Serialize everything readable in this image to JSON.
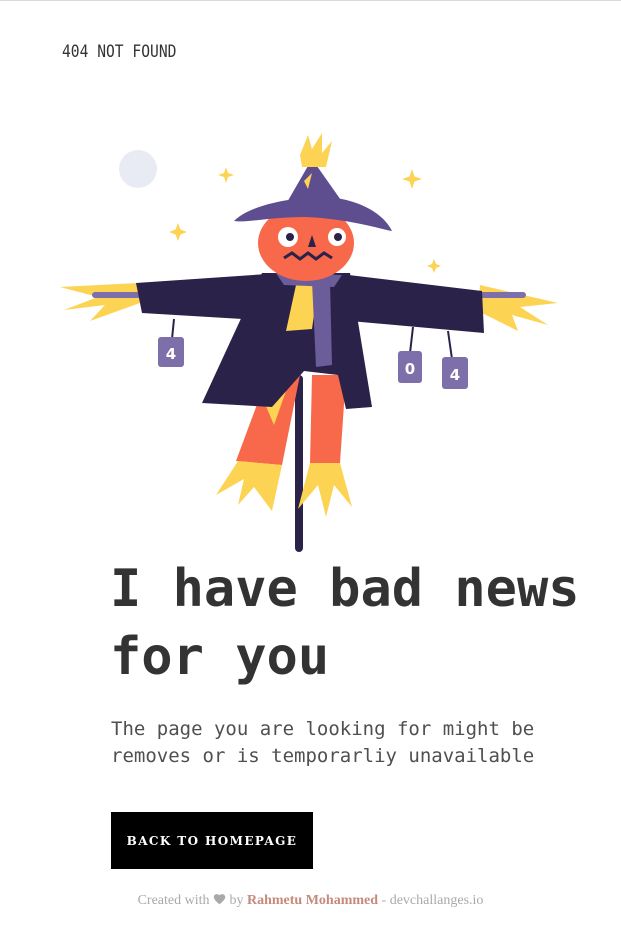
{
  "header": {
    "brand": "404 NOT FOUND"
  },
  "illustration": {
    "cans": [
      "4",
      "0",
      "4"
    ],
    "colors": {
      "hat": "#5e4d8f",
      "coat": "#2a2249",
      "face": "#f8684b",
      "straw": "#fcd353",
      "scarf": "#6b5c9a",
      "can": "#7c6faa",
      "moon": "#e9ebf4"
    }
  },
  "main": {
    "headline": [
      "I have bad news",
      "for you"
    ],
    "message": [
      "The page you are looking for might be",
      "removes or is temporarliy unavailable"
    ],
    "button_label": "BACK TO HOMEPAGE"
  },
  "footer": {
    "created_with": "Created with",
    "by": "by",
    "author": "Rahmetu Mohammed",
    "separator": "-",
    "site": "devchallanges.io",
    "heart_icon": "heart-icon"
  }
}
